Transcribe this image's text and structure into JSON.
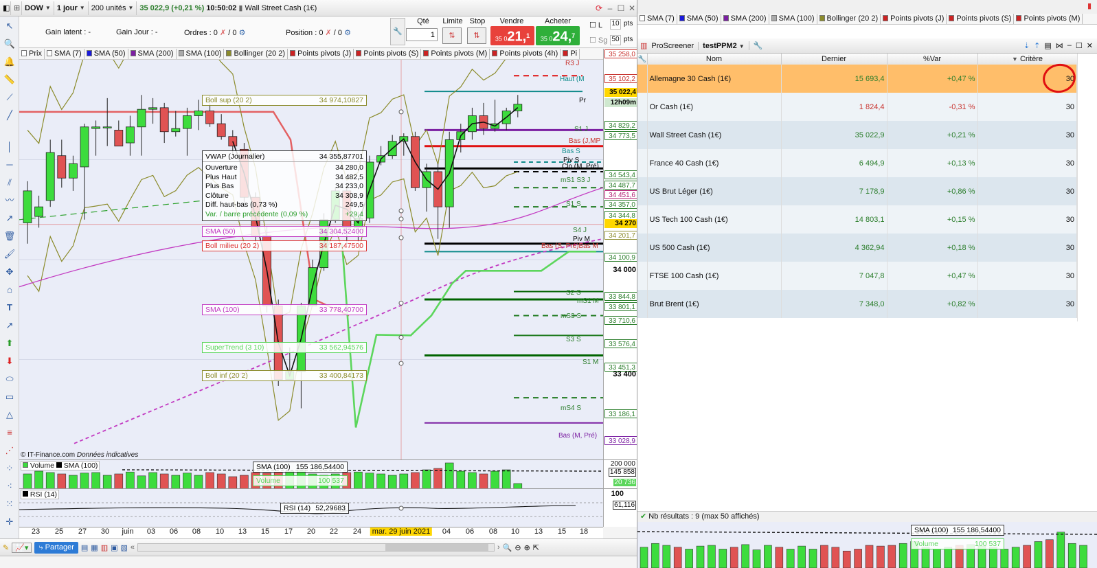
{
  "chart_window": {
    "symbol": "DOW",
    "period": "1 jour",
    "units": "200 unités",
    "price_header": "35 022,9 (+0,21 %)",
    "time": "10:50:02",
    "instrument": "Wall Street Cash (1€)"
  },
  "order_bar": {
    "gain_latent_label": "Gain latent :",
    "gain_latent_value": "-",
    "gain_jour_label": "Gain Jour :",
    "gain_jour_value": "-",
    "ordres_label": "Ordres :",
    "ordres_a": "0",
    "ordres_b": "/ 0",
    "position_label": "Position :",
    "position_a": "0",
    "position_b": "/ 0",
    "qte_label": "Qté",
    "qte_value": "1",
    "limite_label": "Limite",
    "stop_label": "Stop",
    "vendre_label": "Vendre",
    "vendre_small": "35 0",
    "vendre_big": "21,",
    "vendre_sup": "1",
    "acheter_label": "Acheter",
    "acheter_small": "35 0",
    "acheter_big": "24,",
    "acheter_sup": "7",
    "l_label": "L",
    "sg_label": "Sg",
    "pts_a": "10",
    "pts_b": "50",
    "pts_label": "pts"
  },
  "indicator_chips": [
    "Prix",
    "SMA (7)",
    "SMA (50)",
    "SMA (200)",
    "SMA (100)",
    "Bollinger (20 2)",
    "Points pivots (J)",
    "Points pivots (S)",
    "Points pivots (M)",
    "Points pivots (4h)",
    "Pi"
  ],
  "chip_colors": [
    "#ffffff",
    "#ffffff",
    "#1a1adc",
    "#7b1fa2",
    "#aaaaaa",
    "#8b8b2b",
    "#cc2222",
    "#cc2222",
    "#cc2222",
    "#cc2222",
    "#cc2222"
  ],
  "price_labels": [
    {
      "t": "35 258,0",
      "c": "#c8322d",
      "bg": "#fff"
    },
    {
      "t": "35 102,2",
      "c": "#c8322d",
      "bg": "#fff"
    },
    {
      "t": "35 022,4",
      "c": "#000",
      "bg": "#ffd700"
    },
    {
      "t": "12h09m",
      "c": "#000",
      "bg": "#cfe8cf"
    },
    {
      "t": "34 829,2",
      "c": "#2a7d2a",
      "bg": "#fff"
    },
    {
      "t": "34 773,5",
      "c": "#2a7d2a",
      "bg": "#fff"
    },
    {
      "t": "34 543,4",
      "c": "#2a7d2a",
      "bg": "#fff"
    },
    {
      "t": "34 487,7",
      "c": "#2a7d2a",
      "bg": "#fff"
    },
    {
      "t": "34 451,6",
      "c": "#b0186f",
      "bg": "#fff"
    },
    {
      "t": "34 357,0",
      "c": "#2a7d2a",
      "bg": "#fff"
    },
    {
      "t": "34 344,8",
      "c": "#2a7d2a",
      "bg": "#fff"
    },
    {
      "t": "34 270",
      "c": "#000",
      "bg": "#ffd700"
    },
    {
      "t": "34 201,7",
      "c": "#8b8b2b",
      "bg": "#fff"
    },
    {
      "t": "34 100,9",
      "c": "#2a7d2a",
      "bg": "#fff"
    },
    {
      "t": "34 000",
      "c": "#000",
      "bg": "transparent"
    },
    {
      "t": "33 844,8",
      "c": "#2a7d2a",
      "bg": "#fff"
    },
    {
      "t": "33 801,1",
      "c": "#2a7d2a",
      "bg": "#fff"
    },
    {
      "t": "33 710,6",
      "c": "#2a7d2a",
      "bg": "#fff"
    },
    {
      "t": "33 576,4",
      "c": "#2a7d2a",
      "bg": "#fff"
    },
    {
      "t": "33 451,3",
      "c": "#2a7d2a",
      "bg": "#fff"
    },
    {
      "t": "33 400",
      "c": "#000",
      "bg": "transparent"
    },
    {
      "t": "33 186,1",
      "c": "#2a7d2a",
      "bg": "#fff"
    },
    {
      "t": "33 028,9",
      "c": "#7b1fa2",
      "bg": "#fff"
    }
  ],
  "pivot_labels": [
    {
      "t": "R3 J",
      "c": "#c8322d"
    },
    {
      "t": "Haut (M",
      "c": "#0e8a8a"
    },
    {
      "t": "Pr",
      "c": "#000"
    },
    {
      "t": "S1 J",
      "c": "#2a7d2a"
    },
    {
      "t": "Bas (J,MP",
      "c": "#c8322d"
    },
    {
      "t": "Bas S",
      "c": "#0e8a8a"
    },
    {
      "t": "Piv S",
      "c": "#000"
    },
    {
      "t": "Clo (M, Pré)",
      "c": "#000"
    },
    {
      "t": "mS1 S3 J",
      "c": "#2a7d2a"
    },
    {
      "t": "S1 S",
      "c": "#2a7d2a"
    },
    {
      "t": "S4 J",
      "c": "#2a7d2a"
    },
    {
      "t": "Piv M",
      "c": "#000"
    },
    {
      "t": "Bas (S, Pré)Bas M",
      "c": "#c8322d"
    },
    {
      "t": "S2 S",
      "c": "#2a7d2a"
    },
    {
      "t": "mS1 M",
      "c": "#2a7d2a"
    },
    {
      "t": "mS3 S",
      "c": "#2a7d2a"
    },
    {
      "t": "S3 S",
      "c": "#2a7d2a"
    },
    {
      "t": "S1 M",
      "c": "#2a7d2a"
    },
    {
      "t": "mS4 S",
      "c": "#2a7d2a"
    },
    {
      "t": "Bas (M, Pré)",
      "c": "#7b1fa2"
    }
  ],
  "boxes": {
    "boll_sup": {
      "name": "Boll sup (20 2)",
      "val": "34 974,10827"
    },
    "vwap": {
      "name": "VWAP (Journalier)",
      "val": "34 355,87701"
    },
    "ouverture": {
      "name": "Ouverture",
      "val": "34 280,0"
    },
    "plus_haut": {
      "name": "Plus Haut",
      "val": "34 482,5"
    },
    "plus_bas": {
      "name": "Plus Bas",
      "val": "34 233,0"
    },
    "cloture": {
      "name": "Clôture",
      "val": "34 308,9"
    },
    "diff": {
      "name": "Diff. haut-bas (0,73 %)",
      "val": "249,5"
    },
    "var": {
      "name": "Var. / barre précédente (0,09 %)",
      "val": "+29,4"
    },
    "sma50": {
      "name": "SMA (50)",
      "val": "34 304,52400"
    },
    "boll_mid": {
      "name": "Boll milieu (20 2)",
      "val": "34 187,47500"
    },
    "sma100": {
      "name": "SMA (100)",
      "val": "33 778,40700"
    },
    "supertrend": {
      "name": "SuperTrend (3 10)",
      "val": "33 562,94576"
    },
    "boll_inf": {
      "name": "Boll inf (20 2)",
      "val": "33 400,84173"
    },
    "vol_sma": {
      "name": "SMA (100)",
      "val": "155 186,54400"
    },
    "vol_volume": {
      "name": "Volume",
      "val": "100 537"
    },
    "rsi": {
      "name": "RSI (14)",
      "val": "52,29683"
    }
  },
  "copyright": "© IT-Finance.com",
  "indicative": "Données indicatives",
  "volume_panel": {
    "label_a": "Volume",
    "label_b": "SMA (100)",
    "scale_a": "200 000",
    "scale_b": "145 858",
    "scale_c": "20 736"
  },
  "rsi_panel": {
    "label": "RSI (14)",
    "scale_a": "100",
    "scale_b": "61,116"
  },
  "x_axis": [
    "23",
    "25",
    "27",
    "30",
    "juin",
    "03",
    "06",
    "08",
    "10",
    "13",
    "15",
    "17",
    "20",
    "22",
    "24",
    "mar. 29 juin 2021",
    "04",
    "06",
    "08",
    "10",
    "13",
    "15",
    "18"
  ],
  "bottom_bar": {
    "share": "Partager"
  },
  "right_top_chips": [
    "SMA (7)",
    "SMA (50)",
    "SMA (200)",
    "SMA (100)",
    "Bollinger (20 2)",
    "Points pivots (J)",
    "Points pivots (S)",
    "Points pivots (M)"
  ],
  "screener": {
    "title": "ProScreener",
    "name": "testPPM2",
    "headers": [
      "Nom",
      "Dernier",
      "%Var",
      "Critère"
    ],
    "rows": [
      {
        "nom": "Allemagne 30 Cash (1€)",
        "dernier": "15 693,4",
        "var": "+0,47 %",
        "crit": "30",
        "dc": "#2a7d2a",
        "vc": "#2a7d2a"
      },
      {
        "nom": "Or Cash (1€)",
        "dernier": "1 824,4",
        "var": "-0,31 %",
        "crit": "30",
        "dc": "#c8322d",
        "vc": "#c8322d"
      },
      {
        "nom": "Wall Street Cash (1€)",
        "dernier": "35 022,9",
        "var": "+0,21 %",
        "crit": "30",
        "dc": "#2a7d2a",
        "vc": "#2a7d2a"
      },
      {
        "nom": "France 40 Cash (1€)",
        "dernier": "6 494,9",
        "var": "+0,13 %",
        "crit": "30",
        "dc": "#2a7d2a",
        "vc": "#2a7d2a"
      },
      {
        "nom": "US Brut Léger (1€)",
        "dernier": "7 178,9",
        "var": "+0,86 %",
        "crit": "30",
        "dc": "#2a7d2a",
        "vc": "#2a7d2a"
      },
      {
        "nom": "US Tech 100 Cash (1€)",
        "dernier": "14 803,1",
        "var": "+0,15 %",
        "crit": "30",
        "dc": "#2a7d2a",
        "vc": "#2a7d2a"
      },
      {
        "nom": "US 500 Cash (1€)",
        "dernier": "4 362,94",
        "var": "+0,18 %",
        "crit": "30",
        "dc": "#2a7d2a",
        "vc": "#2a7d2a"
      },
      {
        "nom": "FTSE 100 Cash (1€)",
        "dernier": "7 047,8",
        "var": "+0,47 %",
        "crit": "30",
        "dc": "#2a7d2a",
        "vc": "#2a7d2a"
      },
      {
        "nom": "Brut Brent (1€)",
        "dernier": "7 348,0",
        "var": "+0,82 %",
        "crit": "30",
        "dc": "#2a7d2a",
        "vc": "#2a7d2a"
      }
    ],
    "results": "Nb résultats : 9 (max 50 affichés)"
  },
  "right_bottom": {
    "sma": "SMA (100)",
    "sma_val": "155 186,54400",
    "vol": "Volume",
    "vol_val": "100 537"
  },
  "candles": [
    {
      "o": 34280,
      "h": 34540,
      "l": 34150,
      "c": 34480
    },
    {
      "o": 34320,
      "h": 34450,
      "l": 34250,
      "c": 34380
    },
    {
      "o": 34420,
      "h": 34800,
      "l": 34380,
      "c": 34720
    },
    {
      "o": 34700,
      "h": 34800,
      "l": 34500,
      "c": 34560
    },
    {
      "o": 34560,
      "h": 34700,
      "l": 34480,
      "c": 34650
    },
    {
      "o": 34630,
      "h": 34900,
      "l": 34300,
      "c": 34880
    },
    {
      "o": 34870,
      "h": 34920,
      "l": 34700,
      "c": 34880
    },
    {
      "o": 34880,
      "h": 35060,
      "l": 34760,
      "c": 34880
    },
    {
      "o": 34860,
      "h": 34920,
      "l": 34760,
      "c": 34760
    },
    {
      "o": 34780,
      "h": 34950,
      "l": 34700,
      "c": 34880
    },
    {
      "o": 34880,
      "h": 35080,
      "l": 34700,
      "c": 34990
    },
    {
      "o": 34990,
      "h": 35060,
      "l": 34900,
      "c": 35000
    },
    {
      "o": 35000,
      "h": 35030,
      "l": 34780,
      "c": 34850
    },
    {
      "o": 34850,
      "h": 34980,
      "l": 34820,
      "c": 34870
    },
    {
      "o": 34870,
      "h": 35000,
      "l": 34700,
      "c": 34950
    },
    {
      "o": 34950,
      "h": 35050,
      "l": 34860,
      "c": 34980
    },
    {
      "o": 34980,
      "h": 35080,
      "l": 34880,
      "c": 34900
    },
    {
      "o": 34900,
      "h": 34960,
      "l": 34800,
      "c": 34820
    },
    {
      "o": 34820,
      "h": 34860,
      "l": 34700,
      "c": 34760
    },
    {
      "o": 34740,
      "h": 34780,
      "l": 34400,
      "c": 34440
    },
    {
      "o": 34440,
      "h": 34470,
      "l": 34120,
      "c": 34200
    },
    {
      "o": 34200,
      "h": 34260,
      "l": 33720,
      "c": 33760
    },
    {
      "o": 33760,
      "h": 33800,
      "l": 33260,
      "c": 33300
    },
    {
      "o": 33300,
      "h": 33500,
      "l": 33300,
      "c": 33350
    },
    {
      "o": 33350,
      "h": 33780,
      "l": 33120,
      "c": 33760
    },
    {
      "o": 33760,
      "h": 34050,
      "l": 33760,
      "c": 34000
    },
    {
      "o": 34000,
      "h": 34340,
      "l": 33980,
      "c": 34300
    },
    {
      "o": 34300,
      "h": 34500,
      "l": 34280,
      "c": 34480
    },
    {
      "o": 34480,
      "h": 34520,
      "l": 34150,
      "c": 34250
    },
    {
      "o": 34250,
      "h": 34350,
      "l": 34160,
      "c": 34310
    },
    {
      "o": 34310,
      "h": 34700,
      "l": 34280,
      "c": 34660
    },
    {
      "o": 34660,
      "h": 34760,
      "l": 34640,
      "c": 34700
    },
    {
      "o": 34700,
      "h": 34830,
      "l": 34680,
      "c": 34790
    },
    {
      "o": 34790,
      "h": 34840,
      "l": 34700,
      "c": 34820
    },
    {
      "o": 34820,
      "h": 34850,
      "l": 34480,
      "c": 34500
    },
    {
      "o": 34500,
      "h": 34650,
      "l": 34350,
      "c": 34600
    },
    {
      "o": 34600,
      "h": 34650,
      "l": 34180,
      "c": 34380
    },
    {
      "o": 34380,
      "h": 34850,
      "l": 34250,
      "c": 34800
    },
    {
      "o": 34800,
      "h": 34900,
      "l": 34720,
      "c": 34850
    },
    {
      "o": 34850,
      "h": 35000,
      "l": 34800,
      "c": 34950
    },
    {
      "o": 34950,
      "h": 35030,
      "l": 34830,
      "c": 34870
    },
    {
      "o": 34870,
      "h": 35050,
      "l": 34850,
      "c": 34900
    },
    {
      "o": 34900,
      "h": 35000,
      "l": 34860,
      "c": 34980
    },
    {
      "o": 34980,
      "h": 35080,
      "l": 34940,
      "c": 35022
    }
  ],
  "volumes": [
    0.55,
    0.65,
    0.6,
    0.55,
    0.5,
    0.58,
    0.6,
    0.5,
    0.55,
    0.62,
    0.48,
    0.6,
    0.55,
    0.5,
    0.58,
    0.5,
    0.6,
    0.55,
    0.45,
    0.5,
    0.6,
    0.58,
    0.6,
    0.65,
    0.7,
    0.55,
    0.5,
    0.55,
    0.6,
    0.62,
    0.58,
    0.55,
    0.5,
    0.55,
    0.6,
    0.7,
    0.75,
    0.95,
    0.65,
    0.6,
    0.55,
    0.65,
    0.7,
    0.2
  ],
  "colors": {
    "up": "#3ddc3d",
    "down": "#e05353",
    "boll": "#8b8b2b",
    "sma50": "#c23ac2",
    "sma100": "#c23ac2",
    "supertrend": "#5cd65c"
  }
}
